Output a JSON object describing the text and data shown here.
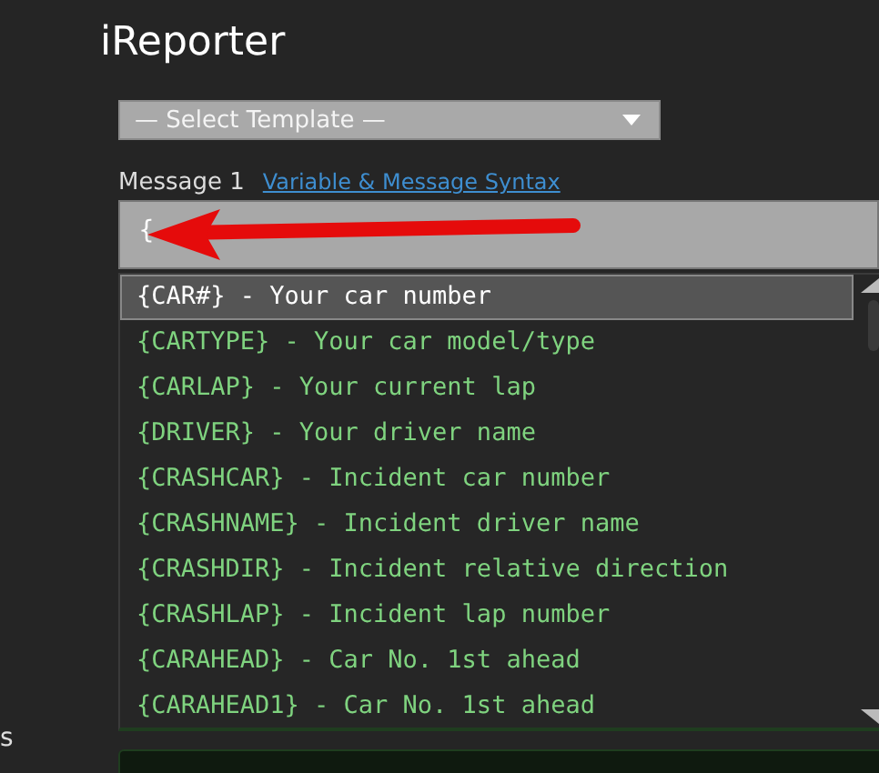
{
  "app": {
    "title": "iReporter"
  },
  "template_select": {
    "value": "— Select Template —"
  },
  "message": {
    "label": "Message 1",
    "link": "Variable & Message Syntax",
    "value": "{"
  },
  "suggestions": [
    {
      "text": "{CAR#} - Your car number",
      "selected": true
    },
    {
      "text": "{CARTYPE} - Your car model/type",
      "selected": false
    },
    {
      "text": "{CARLAP} - Your current lap",
      "selected": false
    },
    {
      "text": "{DRIVER} - Your driver name",
      "selected": false
    },
    {
      "text": "{CRASHCAR} - Incident car number",
      "selected": false
    },
    {
      "text": "{CRASHNAME} - Incident driver name",
      "selected": false
    },
    {
      "text": "{CRASHDIR} - Incident relative direction",
      "selected": false
    },
    {
      "text": "{CRASHLAP} - Incident lap number",
      "selected": false
    },
    {
      "text": "{CARAHEAD} - Car No. 1st ahead",
      "selected": false
    },
    {
      "text": "{CARAHEAD1} - Car No. 1st ahead",
      "selected": false
    }
  ],
  "side_label": "s"
}
